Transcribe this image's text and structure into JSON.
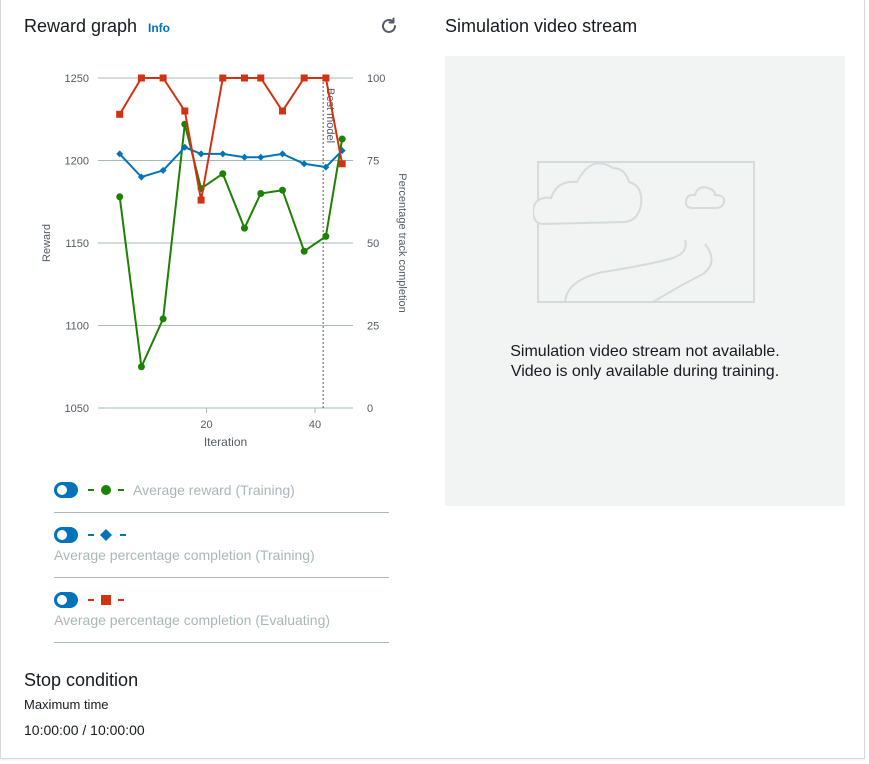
{
  "reward_graph": {
    "title": "Reward graph",
    "info_label": "Info",
    "refresh_icon": "refresh-icon"
  },
  "chart_data": {
    "type": "line",
    "xlabel": "Iteration",
    "ylabel": "Reward",
    "y2label": "Percentage track completion",
    "xlim": [
      0,
      47
    ],
    "ylim": [
      1050,
      1250
    ],
    "y2lim": [
      0,
      100
    ],
    "xticks": [
      20,
      40
    ],
    "yticks": [
      1050,
      1100,
      1150,
      1200,
      1250
    ],
    "y2ticks": [
      0,
      25,
      50,
      75,
      100
    ],
    "grid": true,
    "annotation": {
      "label": "Best model",
      "x": 41.5
    },
    "series": [
      {
        "name": "Average reward (Training)",
        "axis": "left",
        "color": "#1d8102",
        "marker": "circle",
        "x": [
          4,
          8,
          12,
          16,
          19,
          23,
          27,
          30,
          34,
          38,
          42,
          45
        ],
        "values": [
          1178,
          1075,
          1104,
          1222,
          1183,
          1192,
          1159,
          1180,
          1182,
          1145,
          1154,
          1213
        ]
      },
      {
        "name": "Average percentage completion (Training)",
        "axis": "right",
        "color": "#0073bb",
        "marker": "diamond",
        "x": [
          4,
          8,
          12,
          16,
          19,
          23,
          27,
          30,
          34,
          38,
          42,
          45
        ],
        "values": [
          77,
          70,
          72,
          79,
          77,
          77,
          76,
          76,
          77,
          74,
          73,
          78
        ]
      },
      {
        "name": "Average percentage completion (Evaluating)",
        "axis": "right",
        "color": "#d13212",
        "marker": "square",
        "x": [
          4,
          8,
          12,
          16,
          19,
          23,
          27,
          30,
          34,
          38,
          42,
          45
        ],
        "values": [
          89,
          100,
          100,
          90,
          63,
          100,
          100,
          100,
          90,
          100,
          100,
          74
        ]
      }
    ]
  },
  "legend": [
    {
      "label": "Average reward (Training)",
      "marker": "circle",
      "color": "#1d8102",
      "enabled": true
    },
    {
      "label": "Average percentage completion (Training)",
      "marker": "diamond",
      "color": "#0073bb",
      "enabled": true
    },
    {
      "label": "Average percentage completion (Evaluating)",
      "marker": "square",
      "color": "#d13212",
      "enabled": true
    }
  ],
  "video": {
    "title": "Simulation video stream",
    "message_line1": "Simulation video stream not available.",
    "message_line2": "Video is only available during training.",
    "placeholder_icon": "image-placeholder-icon"
  },
  "stop_condition": {
    "title": "Stop condition",
    "label": "Maximum time",
    "value": "10:00:00 / 10:00:00"
  }
}
